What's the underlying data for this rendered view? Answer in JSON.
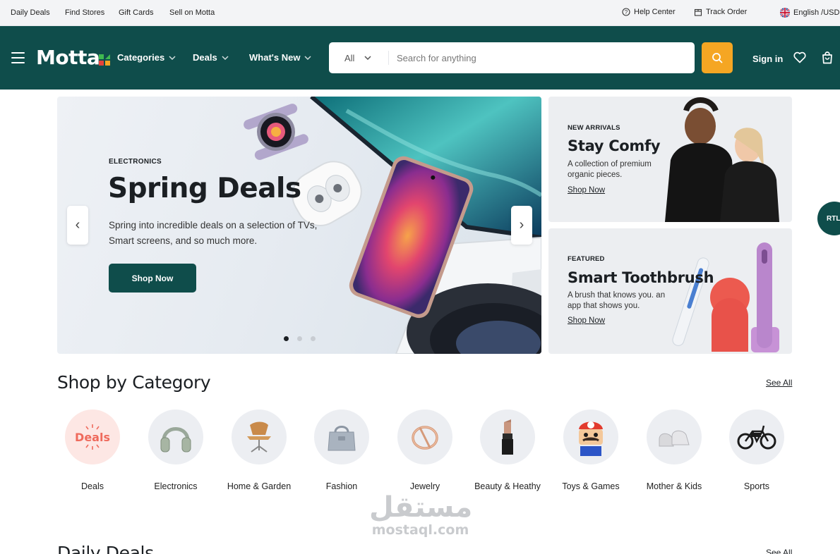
{
  "topbar": {
    "links": [
      "Daily Deals",
      "Find Stores",
      "Gift Cards",
      "Sell on Motta"
    ],
    "help": "Help Center",
    "track": "Track Order",
    "language": "English /USD"
  },
  "header": {
    "logo": "Motta",
    "nav": [
      "Categories",
      "Deals",
      "What's New"
    ],
    "search": {
      "category": "All",
      "placeholder": "Search for anything"
    },
    "signin": "Sign in"
  },
  "hero": {
    "category": "ELECTRONICS",
    "title": "Spring Deals",
    "description": "Spring into incredible deals on a selection of TVs, Smart screens, and so much more.",
    "button": "Shop Now",
    "slide_count": 3,
    "active_slide": 1
  },
  "promos": [
    {
      "tag": "NEW ARRIVALS",
      "title": "Stay Comfy",
      "description": "A collection of premium organic pieces.",
      "link": "Shop Now"
    },
    {
      "tag": "FEATURED",
      "title": "Smart Toothbrush",
      "description": "A brush that knows you. an app that shows you.",
      "link": "Shop Now"
    }
  ],
  "rtl_label": "RTL",
  "categories": {
    "title": "Shop by Category",
    "see_all": "See All",
    "deals_badge": "Deals",
    "items": [
      {
        "label": "Deals",
        "icon": "deals-icon"
      },
      {
        "label": "Electronics",
        "icon": "headphones-icon"
      },
      {
        "label": "Home & Garden",
        "icon": "chair-icon"
      },
      {
        "label": "Fashion",
        "icon": "handbag-icon"
      },
      {
        "label": "Jewelry",
        "icon": "ring-icon"
      },
      {
        "label": "Beauty & Heathy",
        "icon": "lipstick-icon"
      },
      {
        "label": "Toys & Games",
        "icon": "toy-figure-icon"
      },
      {
        "label": "Mother & Kids",
        "icon": "baby-shoes-icon"
      },
      {
        "label": "Sports",
        "icon": "bicycle-icon"
      }
    ]
  },
  "daily_deals": {
    "title": "Daily Deals",
    "see_all": "See All"
  },
  "watermark": {
    "arabic": "مستقل",
    "latin": "mostaql.com"
  },
  "colors": {
    "brand": "#0f4d4b",
    "accent": "#f5a623"
  }
}
